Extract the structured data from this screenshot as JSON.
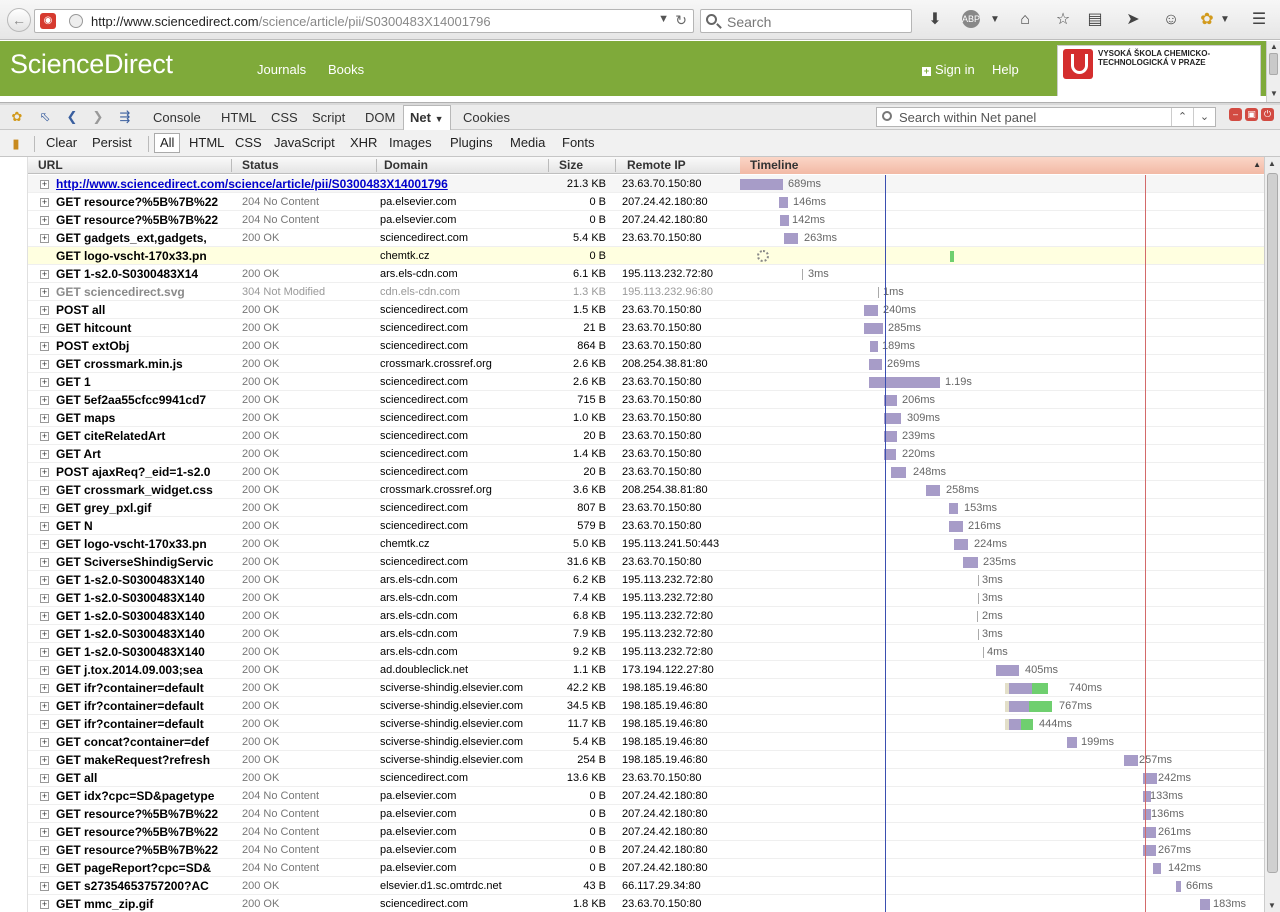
{
  "browser": {
    "url_host": "http://www.sciencedirect.com",
    "url_path": "/science/article/pii/S0300483X14001796",
    "search_placeholder": "Search"
  },
  "site": {
    "logo": "ScienceDirect",
    "nav": [
      "Journals",
      "Books"
    ],
    "sign_in": "Sign in",
    "help": "Help",
    "partner_logo_text": "VYSOKÁ ŠKOLA CHEMICKO-TECHNOLOGICKÁ V PRAZE"
  },
  "firebug": {
    "tabs": [
      "Console",
      "HTML",
      "CSS",
      "Script",
      "DOM",
      "Net",
      "Cookies"
    ],
    "active_tab": "Net",
    "search_placeholder": "Search within Net panel",
    "net_buttons": [
      "Clear",
      "Persist"
    ],
    "filters": [
      "All",
      "HTML",
      "CSS",
      "JavaScript",
      "XHR",
      "Images",
      "Plugins",
      "Media",
      "Fonts"
    ],
    "active_filter": "All"
  },
  "columns": [
    "URL",
    "Status",
    "Domain",
    "Size",
    "Remote IP",
    "Timeline"
  ],
  "requests": [
    {
      "url": "http://www.sciencedirect.com/science/article/pii/S0300483X14001796",
      "status": "",
      "domain": "",
      "size": "21.3 KB",
      "ip": "23.63.70.150:80",
      "time": "689ms"
    },
    {
      "url": "GET resource?%5B%7B%22",
      "status": "204 No Content",
      "domain": "pa.elsevier.com",
      "size": "0 B",
      "ip": "207.24.42.180:80",
      "time": "146ms"
    },
    {
      "url": "GET resource?%5B%7B%22",
      "status": "204 No Content",
      "domain": "pa.elsevier.com",
      "size": "0 B",
      "ip": "207.24.42.180:80",
      "time": "142ms"
    },
    {
      "url": "GET gadgets_ext,gadgets,",
      "status": "200 OK",
      "domain": "sciencedirect.com",
      "size": "5.4 KB",
      "ip": "23.63.70.150:80",
      "time": "263ms"
    },
    {
      "url": "GET logo-vscht-170x33.pn",
      "status": "",
      "domain": "chemtk.cz",
      "size": "0 B",
      "ip": "",
      "time": ""
    },
    {
      "url": "GET 1-s2.0-S0300483X14",
      "status": "200 OK",
      "domain": "ars.els-cdn.com",
      "size": "6.1 KB",
      "ip": "195.113.232.72:80",
      "time": "3ms"
    },
    {
      "url": "GET sciencedirect.svg",
      "status": "304 Not Modified",
      "domain": "cdn.els-cdn.com",
      "size": "1.3 KB",
      "ip": "195.113.232.96:80",
      "time": "1ms"
    },
    {
      "url": "POST all",
      "status": "200 OK",
      "domain": "sciencedirect.com",
      "size": "1.5 KB",
      "ip": "23.63.70.150:80",
      "time": "240ms"
    },
    {
      "url": "GET hitcount",
      "status": "200 OK",
      "domain": "sciencedirect.com",
      "size": "21 B",
      "ip": "23.63.70.150:80",
      "time": "285ms"
    },
    {
      "url": "POST extObj",
      "status": "200 OK",
      "domain": "sciencedirect.com",
      "size": "864 B",
      "ip": "23.63.70.150:80",
      "time": "189ms"
    },
    {
      "url": "GET crossmark.min.js",
      "status": "200 OK",
      "domain": "crossmark.crossref.org",
      "size": "2.6 KB",
      "ip": "208.254.38.81:80",
      "time": "269ms"
    },
    {
      "url": "GET 1",
      "status": "200 OK",
      "domain": "sciencedirect.com",
      "size": "2.6 KB",
      "ip": "23.63.70.150:80",
      "time": "1.19s"
    },
    {
      "url": "GET 5ef2aa55cfcc9941cd7",
      "status": "200 OK",
      "domain": "sciencedirect.com",
      "size": "715 B",
      "ip": "23.63.70.150:80",
      "time": "206ms"
    },
    {
      "url": "GET maps",
      "status": "200 OK",
      "domain": "sciencedirect.com",
      "size": "1.0 KB",
      "ip": "23.63.70.150:80",
      "time": "309ms"
    },
    {
      "url": "GET citeRelatedArt",
      "status": "200 OK",
      "domain": "sciencedirect.com",
      "size": "20 B",
      "ip": "23.63.70.150:80",
      "time": "239ms"
    },
    {
      "url": "GET Art",
      "status": "200 OK",
      "domain": "sciencedirect.com",
      "size": "1.4 KB",
      "ip": "23.63.70.150:80",
      "time": "220ms"
    },
    {
      "url": "POST ajaxReq?_eid=1-s2.0",
      "status": "200 OK",
      "domain": "sciencedirect.com",
      "size": "20 B",
      "ip": "23.63.70.150:80",
      "time": "248ms"
    },
    {
      "url": "GET crossmark_widget.css",
      "status": "200 OK",
      "domain": "crossmark.crossref.org",
      "size": "3.6 KB",
      "ip": "208.254.38.81:80",
      "time": "258ms"
    },
    {
      "url": "GET grey_pxl.gif",
      "status": "200 OK",
      "domain": "sciencedirect.com",
      "size": "807 B",
      "ip": "23.63.70.150:80",
      "time": "153ms"
    },
    {
      "url": "GET N",
      "status": "200 OK",
      "domain": "sciencedirect.com",
      "size": "579 B",
      "ip": "23.63.70.150:80",
      "time": "216ms"
    },
    {
      "url": "GET logo-vscht-170x33.pn",
      "status": "200 OK",
      "domain": "chemtk.cz",
      "size": "5.0 KB",
      "ip": "195.113.241.50:443",
      "time": "224ms"
    },
    {
      "url": "GET SciverseShindigServic",
      "status": "200 OK",
      "domain": "sciencedirect.com",
      "size": "31.6 KB",
      "ip": "23.63.70.150:80",
      "time": "235ms"
    },
    {
      "url": "GET 1-s2.0-S0300483X140",
      "status": "200 OK",
      "domain": "ars.els-cdn.com",
      "size": "6.2 KB",
      "ip": "195.113.232.72:80",
      "time": "3ms"
    },
    {
      "url": "GET 1-s2.0-S0300483X140",
      "status": "200 OK",
      "domain": "ars.els-cdn.com",
      "size": "7.4 KB",
      "ip": "195.113.232.72:80",
      "time": "3ms"
    },
    {
      "url": "GET 1-s2.0-S0300483X140",
      "status": "200 OK",
      "domain": "ars.els-cdn.com",
      "size": "6.8 KB",
      "ip": "195.113.232.72:80",
      "time": "2ms"
    },
    {
      "url": "GET 1-s2.0-S0300483X140",
      "status": "200 OK",
      "domain": "ars.els-cdn.com",
      "size": "7.9 KB",
      "ip": "195.113.232.72:80",
      "time": "3ms"
    },
    {
      "url": "GET 1-s2.0-S0300483X140",
      "status": "200 OK",
      "domain": "ars.els-cdn.com",
      "size": "9.2 KB",
      "ip": "195.113.232.72:80",
      "time": "4ms"
    },
    {
      "url": "GET j.tox.2014.09.003;sea",
      "status": "200 OK",
      "domain": "ad.doubleclick.net",
      "size": "1.1 KB",
      "ip": "173.194.122.27:80",
      "time": "405ms"
    },
    {
      "url": "GET ifr?container=default",
      "status": "200 OK",
      "domain": "sciverse-shindig.elsevier.com",
      "size": "42.2 KB",
      "ip": "198.185.19.46:80",
      "time": "740ms"
    },
    {
      "url": "GET ifr?container=default",
      "status": "200 OK",
      "domain": "sciverse-shindig.elsevier.com",
      "size": "34.5 KB",
      "ip": "198.185.19.46:80",
      "time": "767ms"
    },
    {
      "url": "GET ifr?container=default",
      "status": "200 OK",
      "domain": "sciverse-shindig.elsevier.com",
      "size": "11.7 KB",
      "ip": "198.185.19.46:80",
      "time": "444ms"
    },
    {
      "url": "GET concat?container=def",
      "status": "200 OK",
      "domain": "sciverse-shindig.elsevier.com",
      "size": "5.4 KB",
      "ip": "198.185.19.46:80",
      "time": "199ms"
    },
    {
      "url": "GET makeRequest?refresh",
      "status": "200 OK",
      "domain": "sciverse-shindig.elsevier.com",
      "size": "254 B",
      "ip": "198.185.19.46:80",
      "time": "257ms"
    },
    {
      "url": "GET all",
      "status": "200 OK",
      "domain": "sciencedirect.com",
      "size": "13.6 KB",
      "ip": "23.63.70.150:80",
      "time": "242ms"
    },
    {
      "url": "GET idx?cpc=SD&pagetype",
      "status": "204 No Content",
      "domain": "pa.elsevier.com",
      "size": "0 B",
      "ip": "207.24.42.180:80",
      "time": "133ms"
    },
    {
      "url": "GET resource?%5B%7B%22",
      "status": "204 No Content",
      "domain": "pa.elsevier.com",
      "size": "0 B",
      "ip": "207.24.42.180:80",
      "time": "136ms"
    },
    {
      "url": "GET resource?%5B%7B%22",
      "status": "204 No Content",
      "domain": "pa.elsevier.com",
      "size": "0 B",
      "ip": "207.24.42.180:80",
      "time": "261ms"
    },
    {
      "url": "GET resource?%5B%7B%22",
      "status": "204 No Content",
      "domain": "pa.elsevier.com",
      "size": "0 B",
      "ip": "207.24.42.180:80",
      "time": "267ms"
    },
    {
      "url": "GET pageReport?cpc=SD&",
      "status": "204 No Content",
      "domain": "pa.elsevier.com",
      "size": "0 B",
      "ip": "207.24.42.180:80",
      "time": "142ms"
    },
    {
      "url": "GET s27354653757200?AC",
      "status": "200 OK",
      "domain": "elsevier.d1.sc.omtrdc.net",
      "size": "43 B",
      "ip": "66.117.29.34:80",
      "time": "66ms"
    },
    {
      "url": "GET mmc_zip.gif",
      "status": "200 OK",
      "domain": "sciencedirect.com",
      "size": "1.8 KB",
      "ip": "23.63.70.150:80",
      "time": "183ms"
    }
  ],
  "colors": {
    "site_green": "#7faa3a",
    "bar_purple": "#a79cc8",
    "bar_green": "#6fcf6f",
    "pending_row": "#ffffe0",
    "timeline_header": "#f2b9a5"
  }
}
